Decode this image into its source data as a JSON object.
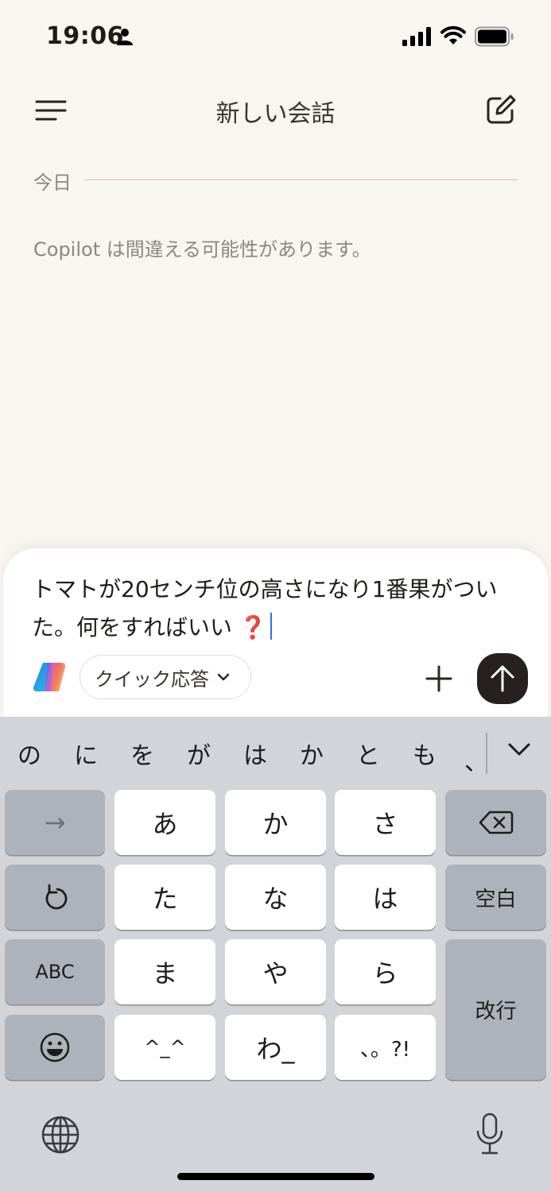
{
  "status_bar": {
    "time": "19:06"
  },
  "header": {
    "title": "新しい会話"
  },
  "chat": {
    "day_label": "今日",
    "disclaimer": "Copilot は間違える可能性があります。"
  },
  "composer": {
    "input_text": "トマトが20センチ位の高さになり1番果がついた。何をすればいい",
    "emoji": "❓",
    "quick_reply_label": "クイック応答"
  },
  "keyboard": {
    "suggestions": [
      "の",
      "に",
      "を",
      "が",
      "は",
      "か",
      "と",
      "も",
      "、"
    ],
    "keys": {
      "arrow": "→",
      "a": "あ",
      "ka": "か",
      "sa": "さ",
      "ta": "た",
      "na": "な",
      "ha": "は",
      "abc": "ABC",
      "ma": "ま",
      "ya": "や",
      "ra": "ら",
      "kaomoji": "^_^",
      "wa": "わ_",
      "punct": "、。?!",
      "space": "空白",
      "return": "改行"
    }
  },
  "colors": {
    "send_button": "#26211e",
    "caret": "#2f6fe4",
    "keyboard_bg": "#d2d4da"
  }
}
